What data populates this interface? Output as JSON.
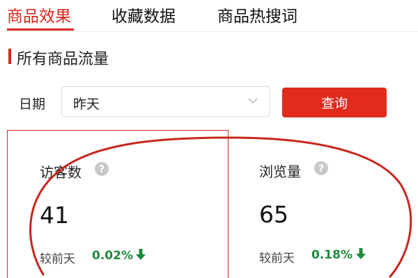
{
  "tabs": [
    {
      "label": "商品效果",
      "active": true
    },
    {
      "label": "收藏数据",
      "active": false
    },
    {
      "label": "商品热搜词",
      "active": false
    }
  ],
  "section": {
    "title": "所有商品流量"
  },
  "filter": {
    "date_label": "日期",
    "date_value": "昨天",
    "query_button": "查询"
  },
  "metrics": [
    {
      "label": "访客数",
      "value": "41",
      "compare_label": "较前天",
      "change": "0.02%",
      "trend": "down"
    },
    {
      "label": "浏览量",
      "value": "65",
      "compare_label": "较前天",
      "change": "0.18%",
      "trend": "down"
    }
  ],
  "colors": {
    "accent": "#d9271d",
    "button": "#e02b1d",
    "trend_down": "#1e8a3e",
    "help_icon": "#c8c8c8"
  },
  "icons": {
    "help": "question-circle-icon",
    "trend": "arrow-down-icon",
    "select": "chevron-down-icon"
  }
}
